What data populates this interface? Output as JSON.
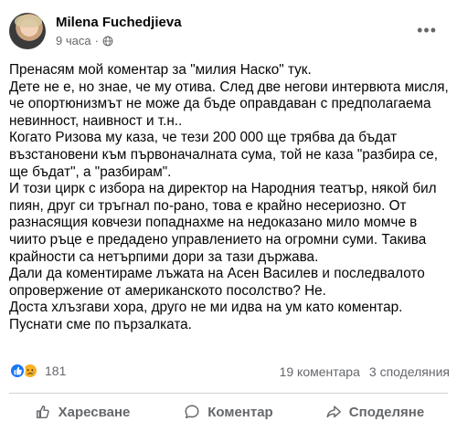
{
  "post": {
    "author": "Milena Fuchedjieva",
    "time": "9 часа",
    "separator": "·",
    "lines": [
      "Пренасям мой коментар за \"милия Наско\" тук.",
      "Дете не е, но знае, че му отива. След две негови интервюта мисля,",
      "че опортюнизмът не може да бъде оправдаван с предполагаема",
      "невинност, наивност и т.н..",
      "Когато Ризова му каза, че тези 200 000 ще трябва да бъдат",
      "възстановени към първоначалната сума, той не каза \"разбира се,",
      "ще бъдат\", а \"разбирам\".",
      "И този цирк с избора на директор на Народния театър, някой бил",
      "пиян, друг си тръгнал по-рано, това е крайно несериозно. От",
      "разнасящия ковчези попаднахме на недоказано мило момче в",
      "чиито ръце е предадено управлението на огромни суми. Такива",
      "крайности са нетърпими дори за тази държава.",
      "Дали да коментираме лъжата на Асен Василев и последвалото",
      "опровержение от американското посолство? Не.",
      "Доста хлъзгави хора, друго не ми идва на ум като коментар.",
      "Пуснати сме по пързалката."
    ]
  },
  "stats": {
    "reaction_count": "181",
    "comments": "19 коментара",
    "shares": "3 споделяния"
  },
  "actions": {
    "like": "Харесване",
    "comment": "Коментар",
    "share": "Споделяне"
  },
  "icons": {
    "privacy": "globe-icon",
    "more": "more-options-icon",
    "reaction_1": "like-reaction-icon",
    "reaction_2": "sad-reaction-icon",
    "like": "thumbs-up-icon",
    "comment": "comment-icon",
    "share": "share-icon"
  },
  "colors": {
    "like_blue": "#1877f2",
    "sad_yellow": "#f7b125",
    "secondary_text": "#65676b"
  }
}
